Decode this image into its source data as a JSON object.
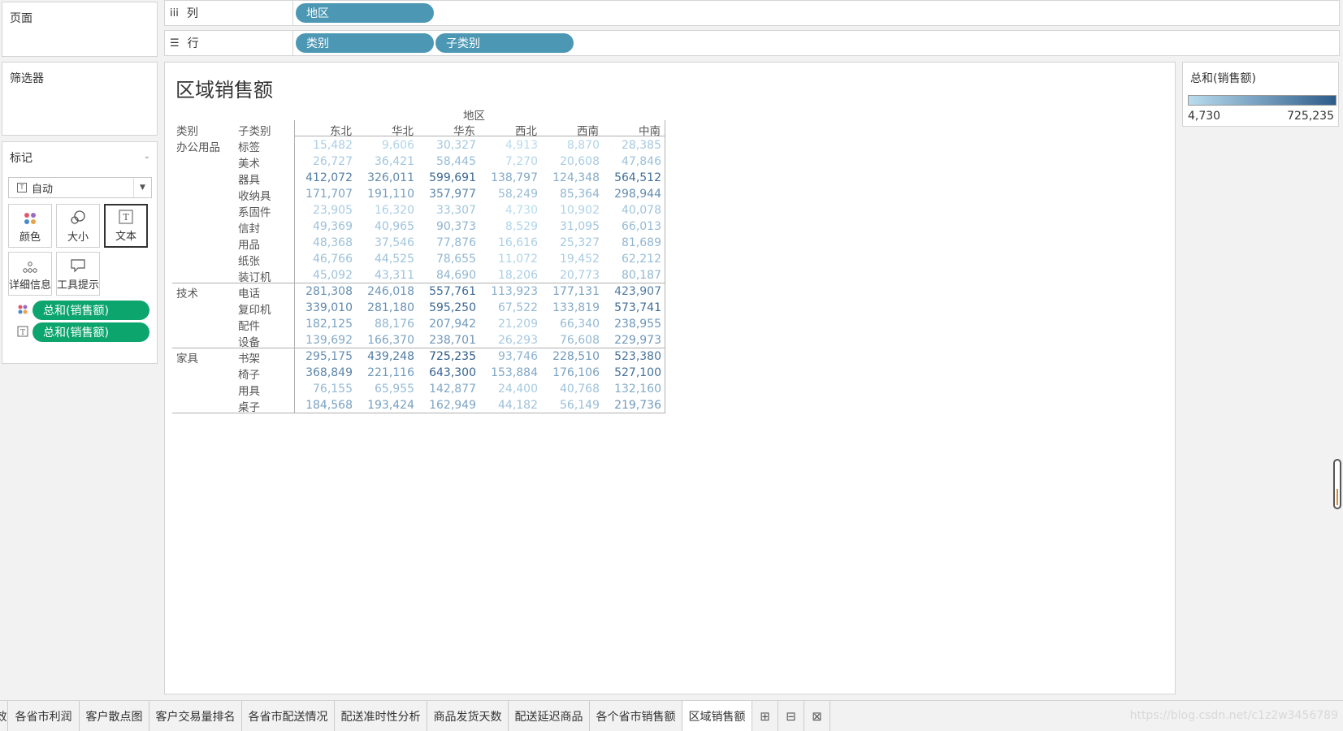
{
  "cards": {
    "pages_title": "页面",
    "filters_title": "筛选器",
    "marks_title": "标记",
    "mark_type": "自动",
    "mark_buttons": {
      "color": "颜色",
      "size": "大小",
      "text": "文本",
      "detail": "详细信息",
      "tooltip": "工具提示"
    },
    "mark_pills": [
      "总和(销售额)",
      "总和(销售额)"
    ]
  },
  "shelves": {
    "columns_label": "列",
    "rows_label": "行",
    "column_pills": [
      "地区"
    ],
    "row_pills": [
      "类别",
      "子类别"
    ]
  },
  "view": {
    "title": "区域销售额"
  },
  "legend": {
    "title": "总和(销售额)",
    "min": "4,730",
    "max": "725,235",
    "color_low": "#b9dcee",
    "color_high": "#2e5c8a"
  },
  "chart_data": {
    "type": "table",
    "column_field": "地区",
    "row_fields": [
      "类别",
      "子类别"
    ],
    "columns": [
      "东北",
      "华北",
      "华东",
      "西北",
      "西南",
      "中南"
    ],
    "groups": [
      {
        "category": "办公用品",
        "rows": [
          {
            "sub": "标签",
            "values": [
              "15,482",
              "9,606",
              "30,327",
              "4,913",
              "8,870",
              "28,385"
            ]
          },
          {
            "sub": "美术",
            "values": [
              "26,727",
              "36,421",
              "58,445",
              "7,270",
              "20,608",
              "47,846"
            ]
          },
          {
            "sub": "器具",
            "values": [
              "412,072",
              "326,011",
              "599,691",
              "138,797",
              "124,348",
              "564,512"
            ]
          },
          {
            "sub": "收纳具",
            "values": [
              "171,707",
              "191,110",
              "357,977",
              "58,249",
              "85,364",
              "298,944"
            ]
          },
          {
            "sub": "系固件",
            "values": [
              "23,905",
              "16,320",
              "33,307",
              "4,730",
              "10,902",
              "40,078"
            ]
          },
          {
            "sub": "信封",
            "values": [
              "49,369",
              "40,965",
              "90,373",
              "8,529",
              "31,095",
              "66,013"
            ]
          },
          {
            "sub": "用品",
            "values": [
              "48,368",
              "37,546",
              "77,876",
              "16,616",
              "25,327",
              "81,689"
            ]
          },
          {
            "sub": "纸张",
            "values": [
              "46,766",
              "44,525",
              "78,655",
              "11,072",
              "19,452",
              "62,212"
            ]
          },
          {
            "sub": "装订机",
            "values": [
              "45,092",
              "43,311",
              "84,690",
              "18,206",
              "20,773",
              "80,187"
            ]
          }
        ]
      },
      {
        "category": "技术",
        "rows": [
          {
            "sub": "电话",
            "values": [
              "281,308",
              "246,018",
              "557,761",
              "113,923",
              "177,131",
              "423,907"
            ]
          },
          {
            "sub": "复印机",
            "values": [
              "339,010",
              "281,180",
              "595,250",
              "67,522",
              "133,819",
              "573,741"
            ]
          },
          {
            "sub": "配件",
            "values": [
              "182,125",
              "88,176",
              "207,942",
              "21,209",
              "66,340",
              "238,955"
            ]
          },
          {
            "sub": "设备",
            "values": [
              "139,692",
              "166,370",
              "238,701",
              "26,293",
              "76,608",
              "229,973"
            ]
          }
        ]
      },
      {
        "category": "家具",
        "rows": [
          {
            "sub": "书架",
            "values": [
              "295,175",
              "439,248",
              "725,235",
              "93,746",
              "228,510",
              "523,380"
            ]
          },
          {
            "sub": "椅子",
            "values": [
              "368,849",
              "221,116",
              "643,300",
              "153,884",
              "176,106",
              "527,100"
            ]
          },
          {
            "sub": "用具",
            "values": [
              "76,155",
              "65,955",
              "142,877",
              "24,400",
              "40,768",
              "132,160"
            ]
          },
          {
            "sub": "桌子",
            "values": [
              "184,568",
              "193,424",
              "162,949",
              "44,182",
              "56,149",
              "219,736"
            ]
          }
        ]
      }
    ]
  },
  "tabs": {
    "items": [
      "效",
      "各省市利润",
      "客户散点图",
      "客户交易量排名",
      "各省市配送情况",
      "配送准时性分析",
      "商品发货天数",
      "配送延迟商品",
      "各个省市销售额",
      "区域销售额"
    ],
    "active_index": 9,
    "icons": [
      "new-worksheet-icon",
      "new-dashboard-icon",
      "new-story-icon"
    ]
  },
  "watermark": "https://blog.csdn.net/c1z2w3456789"
}
